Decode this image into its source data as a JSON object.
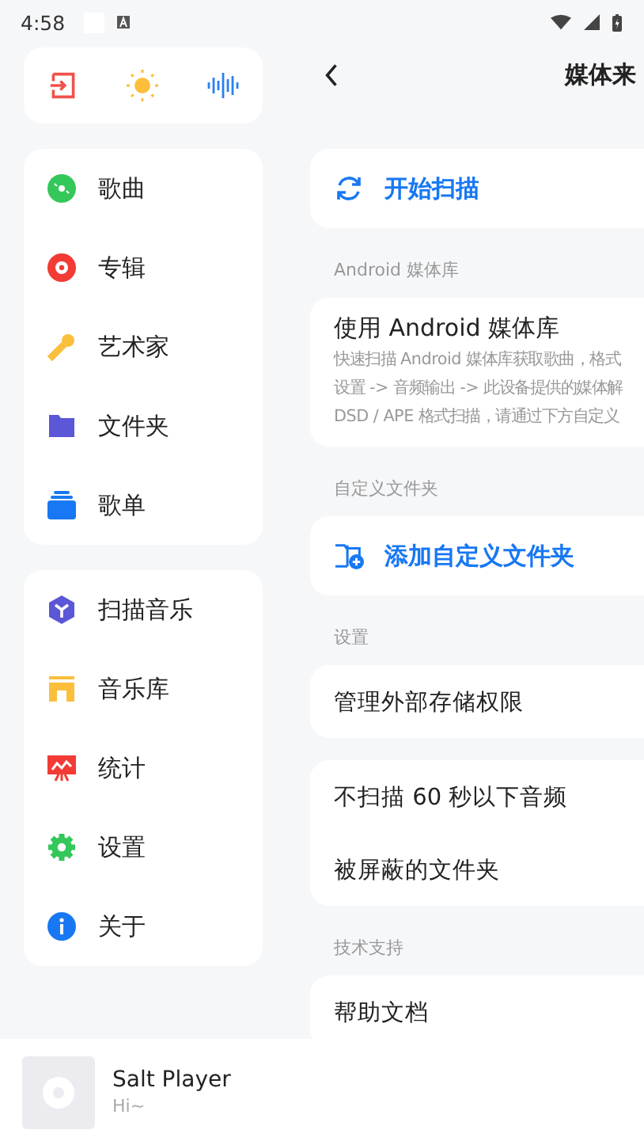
{
  "status_bar": {
    "time": "4:58"
  },
  "menus": [
    {
      "items": [
        {
          "kind": "song",
          "label": "歌曲"
        },
        {
          "kind": "album",
          "label": "专辑"
        },
        {
          "kind": "artist",
          "label": "艺术家"
        },
        {
          "kind": "folder",
          "label": "文件夹"
        },
        {
          "kind": "playlist",
          "label": "歌单"
        }
      ]
    },
    {
      "items": [
        {
          "kind": "scan",
          "label": "扫描音乐"
        },
        {
          "kind": "library",
          "label": "音乐库"
        },
        {
          "kind": "stats",
          "label": "统计"
        },
        {
          "kind": "settings",
          "label": "设置"
        },
        {
          "kind": "about",
          "label": "关于"
        }
      ]
    }
  ],
  "header": {
    "title": "媒体来"
  },
  "sections": [
    {
      "rows": [
        {
          "kind": "scan",
          "text": "开始扫描"
        }
      ]
    },
    {
      "heading": "Android 媒体库",
      "rows": [
        {
          "kind": "detail",
          "text": "使用 Android 媒体库",
          "lines": [
            "快速扫描 Android 媒体库获取歌曲，格式",
            "设置 -> 音频输出 -> 此设备提供的媒体解",
            "DSD / APE 格式扫描，请通过下方自定义"
          ]
        }
      ]
    },
    {
      "heading": "自定义文件夹",
      "rows": [
        {
          "kind": "add-folder",
          "text": "添加自定义文件夹"
        }
      ]
    },
    {
      "heading": "设置",
      "rows": [
        {
          "kind": "plain",
          "text": "管理外部存储权限"
        }
      ]
    },
    {
      "rows": [
        {
          "kind": "plain",
          "text": "不扫描 60 秒以下音频"
        },
        {
          "kind": "plain",
          "text": "被屏蔽的文件夹"
        }
      ]
    },
    {
      "heading": "技术支持",
      "rows": [
        {
          "kind": "plain",
          "text": "帮助文档"
        }
      ]
    }
  ],
  "player": {
    "title": "Salt Player",
    "subtitle": "Hi~"
  }
}
